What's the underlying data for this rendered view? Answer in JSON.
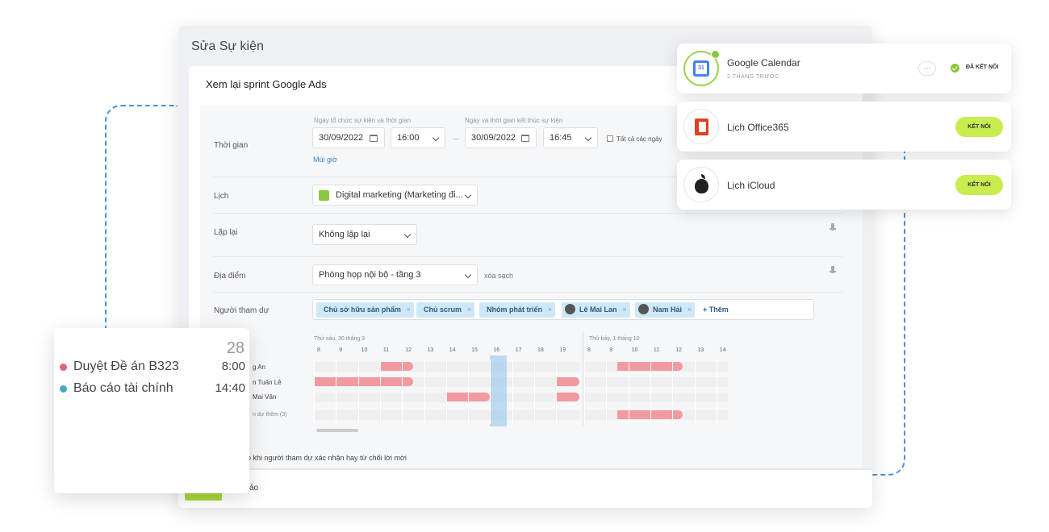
{
  "editor": {
    "title": "Sửa Sự kiện",
    "event_name": "Xem lại sprint Google Ads",
    "time": {
      "label": "Thời gian",
      "start_hint": "Ngày tổ chức sự kiện và thời gian",
      "end_hint": "Ngày và thời gian kết thúc sự kiện",
      "start_date": "30/09/2022",
      "start_time": "16:00",
      "separator": "—",
      "end_date": "30/09/2022",
      "end_time": "16:45",
      "all_day": "Tất cả các ngày",
      "timezone_link": "Múi giờ"
    },
    "calendar": {
      "label": "Lịch",
      "value": "Digital marketing (Marketing đi...",
      "color": "#8cc63f"
    },
    "repeat": {
      "label": "Lặp lại",
      "value": "Không lặp lại"
    },
    "location": {
      "label": "Địa điểm",
      "value": "Phòng họp nội bộ - tầng 3",
      "clear": "xóa sạch"
    },
    "attendees": {
      "label": "Người tham dự",
      "tags": [
        "Chủ sở hữu sản phẩm",
        "Chủ scrum",
        "Nhóm phát triển",
        "Lê Mai Lan",
        "Nam Hải"
      ],
      "add_more": "+ Thêm"
    },
    "schedule": {
      "day1": "Thứ sáu, 30 tháng 9",
      "day2": "Thứ bảy, 1 tháng 10",
      "hours1": [
        "8",
        "9",
        "10",
        "11",
        "12",
        "13",
        "14",
        "15",
        "16",
        "17",
        "18",
        "19"
      ],
      "hours2": [
        "8",
        "9",
        "10",
        "11",
        "12",
        "13",
        "14"
      ],
      "people": [
        "g An",
        "n Tuấn Lê",
        "Mai Vân",
        "n dự thêm (3)"
      ]
    },
    "notify_text": "báo khi người tham dự xác nhận hay từ chối lời mời",
    "footer_text": "ảo"
  },
  "integrations": [
    {
      "name": "Google Calendar",
      "sub": "2 THÁNG TRƯỚC",
      "status": "ĐÃ KẾT NỐI",
      "more": "···",
      "icon_text": "31"
    },
    {
      "name": "Lịch Office365",
      "button": "KẾT NỐI"
    },
    {
      "name": "Lịch iCloud",
      "button": "KẾT NỐI"
    }
  ],
  "mini_calendar": {
    "date": "28",
    "events": [
      {
        "name": "Duyệt Đề án B323",
        "time": "8:00",
        "color": "#d9667a"
      },
      {
        "name": "Báo cáo tài chính",
        "time": "14:40",
        "color": "#4aa8c7"
      }
    ]
  }
}
